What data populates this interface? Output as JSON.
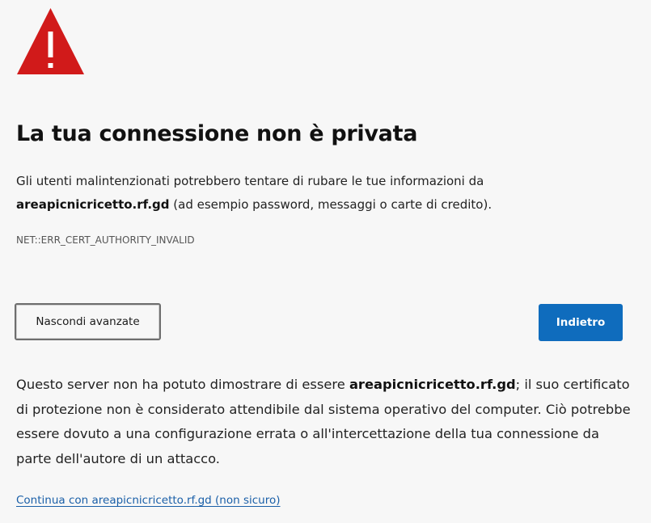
{
  "icon": "warning-triangle-icon",
  "colors": {
    "warning": "#d11a1a",
    "primary_button": "#0f6cbd",
    "link": "#1a5fa8"
  },
  "title": "La tua connessione non è privata",
  "summary": {
    "before": "Gli utenti malintenzionati potrebbero tentare di rubare le tue informazioni da",
    "host": "areapicnicricetto.rf.gd",
    "after": " (ad esempio password, messaggi o carte di credito)."
  },
  "error_code": "NET::ERR_CERT_AUTHORITY_INVALID",
  "buttons": {
    "advanced_label": "Nascondi avanzate",
    "back_label": "Indietro"
  },
  "details": {
    "before": "Questo server non ha potuto dimostrare di essere ",
    "host": "areapicnicricetto.rf.gd",
    "after": "; il suo certificato di protezione non è considerato attendibile dal sistema operativo del computer. Ciò potrebbe essere dovuto a una configurazione errata o all'intercettazione della tua connessione da parte dell'autore di un attacco."
  },
  "continue_link": "Continua con areapicnicricetto.rf.gd (non sicuro)"
}
